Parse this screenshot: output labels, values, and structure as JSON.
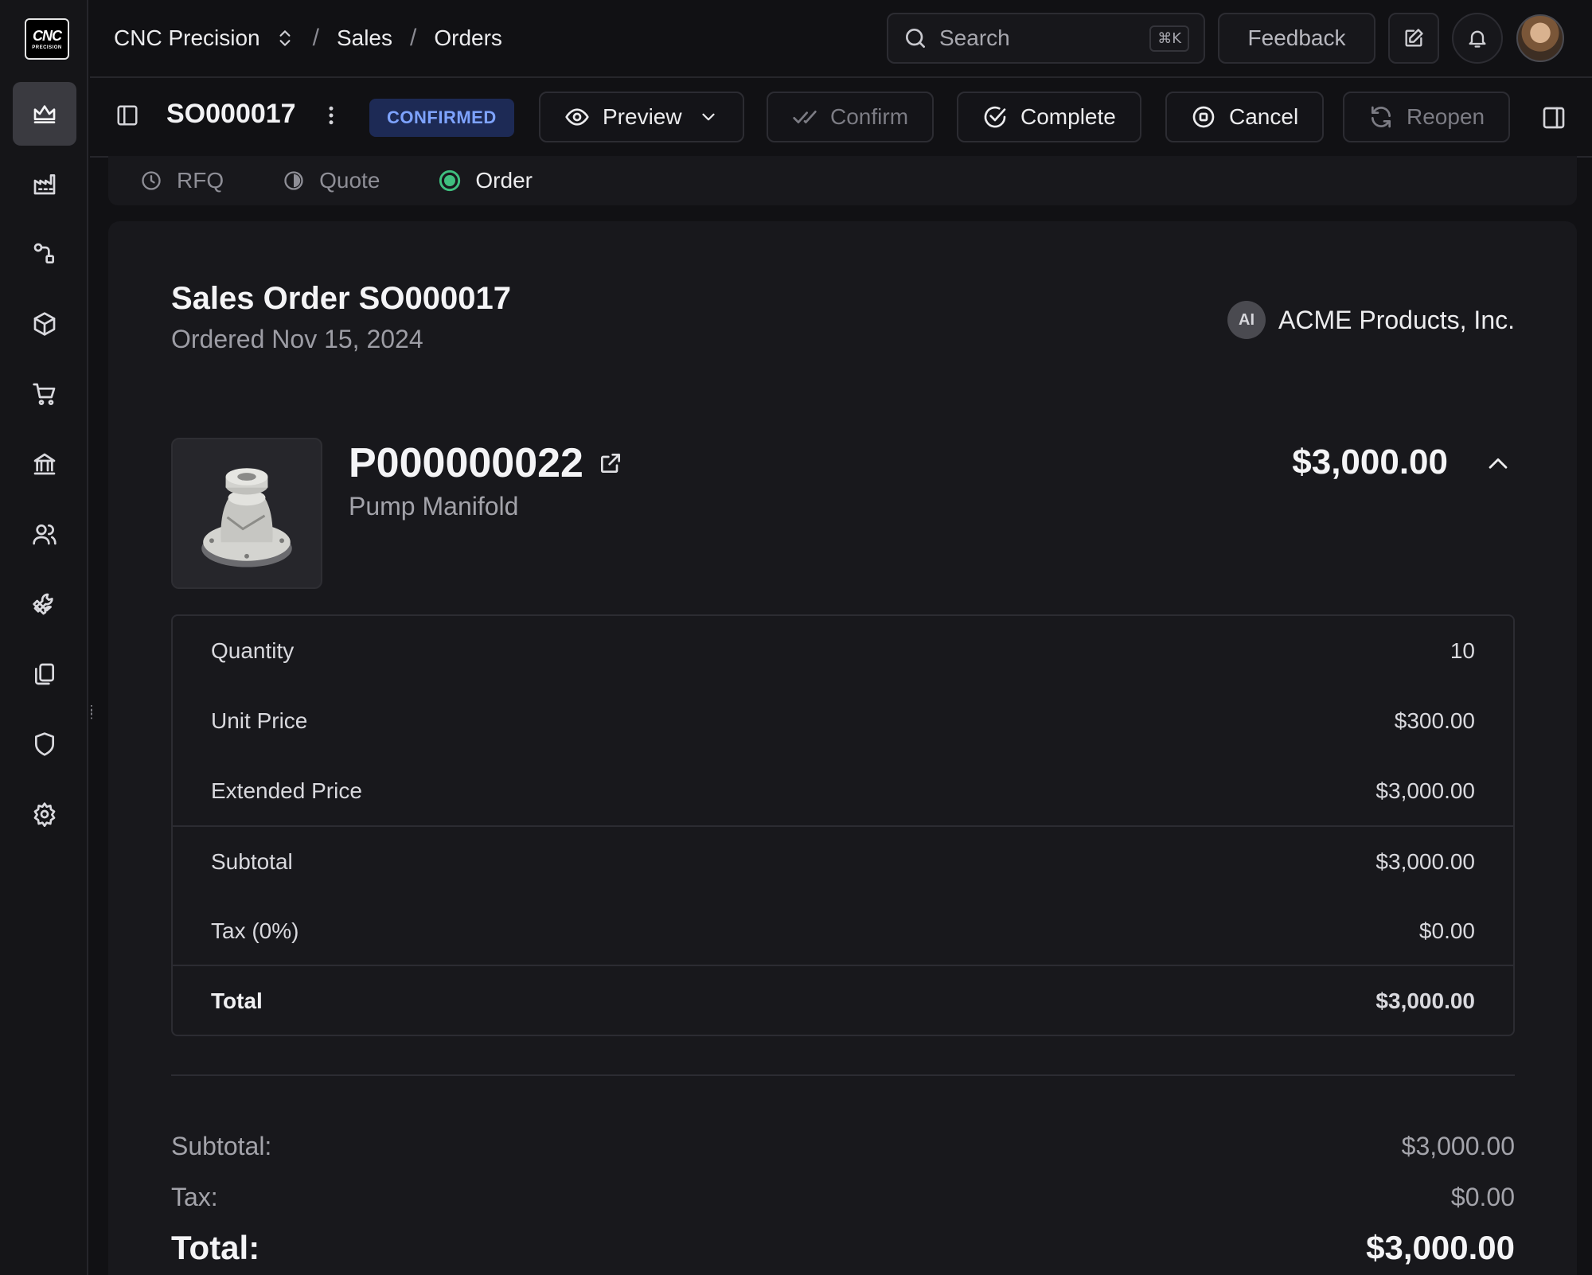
{
  "app": {
    "logo_line1": "CNC",
    "logo_line2": "PRECISION",
    "company": "CNC Precision"
  },
  "breadcrumb": [
    "Sales",
    "Orders"
  ],
  "search": {
    "placeholder": "Search",
    "shortcut": "⌘K"
  },
  "header": {
    "feedback_label": "Feedback"
  },
  "sidebar": {
    "items": [
      {
        "icon": "crown-icon",
        "active": true
      },
      {
        "icon": "factory-icon"
      },
      {
        "icon": "route-icon"
      },
      {
        "icon": "box-icon"
      },
      {
        "icon": "cart-icon"
      },
      {
        "icon": "bank-icon"
      },
      {
        "icon": "users-icon"
      },
      {
        "icon": "wrench-icon"
      },
      {
        "icon": "files-icon"
      },
      {
        "icon": "shield-icon"
      },
      {
        "icon": "settings-icon"
      }
    ]
  },
  "toolbar": {
    "order_id": "SO000017",
    "status": "CONFIRMED",
    "preview_label": "Preview",
    "confirm_label": "Confirm",
    "complete_label": "Complete",
    "cancel_label": "Cancel",
    "reopen_label": "Reopen"
  },
  "steps": [
    {
      "label": "RFQ",
      "state": "done"
    },
    {
      "label": "Quote",
      "state": "done"
    },
    {
      "label": "Order",
      "state": "active"
    }
  ],
  "order": {
    "title": "Sales Order SO000017",
    "date": "Ordered Nov 15, 2024",
    "customer_initials": "AI",
    "customer_name": "ACME Products, Inc."
  },
  "line": {
    "part_number": "P000000022",
    "description": "Pump Manifold",
    "amount": "$3,000.00",
    "rows": [
      {
        "label": "Quantity",
        "value": "10"
      },
      {
        "label": "Unit Price",
        "value": "$300.00"
      },
      {
        "label": "Extended Price",
        "value": "$3,000.00"
      },
      {
        "label": "Subtotal",
        "value": "$3,000.00"
      },
      {
        "label": "Tax (0%)",
        "value": "$0.00"
      },
      {
        "label": "Total",
        "value": "$3,000.00"
      }
    ]
  },
  "summary": {
    "subtotal_label": "Subtotal:",
    "subtotal_value": "$3,000.00",
    "tax_label": "Tax:",
    "tax_value": "$0.00",
    "total_label": "Total:",
    "total_value": "$3,000.00"
  },
  "colors": {
    "accent_badge_bg": "#1d2a55",
    "accent_badge_text": "#7ea3ff",
    "step_active": "#3fbf7f",
    "background": "#111114",
    "card": "#18181c"
  }
}
